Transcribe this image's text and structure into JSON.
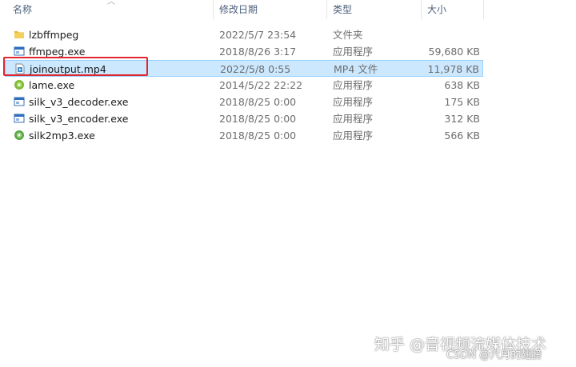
{
  "columns": {
    "name": "名称",
    "date": "修改日期",
    "type": "类型",
    "size": "大小"
  },
  "files": [
    {
      "name": "lzbffmpeg",
      "date": "2022/5/7 23:54",
      "type": "文件夹",
      "size": "",
      "icon": "folder-icon"
    },
    {
      "name": "ffmpeg.exe",
      "date": "2018/8/26 3:17",
      "type": "应用程序",
      "size": "59,680 KB",
      "icon": "exe-window-icon"
    },
    {
      "name": "joinoutput.mp4",
      "date": "2022/5/8 0:55",
      "type": "MP4 文件",
      "size": "11,978 KB",
      "icon": "video-file-icon"
    },
    {
      "name": "lame.exe",
      "date": "2014/5/22 22:22",
      "type": "应用程序",
      "size": "638 KB",
      "icon": "green-disc-icon"
    },
    {
      "name": "silk_v3_decoder.exe",
      "date": "2018/8/25 0:00",
      "type": "应用程序",
      "size": "175 KB",
      "icon": "exe-window-icon"
    },
    {
      "name": "silk_v3_encoder.exe",
      "date": "2018/8/25 0:00",
      "type": "应用程序",
      "size": "312 KB",
      "icon": "exe-window-icon"
    },
    {
      "name": "silk2mp3.exe",
      "date": "2018/8/25 0:00",
      "type": "应用程序",
      "size": "566 KB",
      "icon": "green-disc-icon"
    }
  ],
  "watermark": {
    "zhihu": "知乎 @音视频流媒体技术",
    "csdn": "CSDN @六月的翅膀"
  },
  "colors": {
    "selection": "#cce8ff",
    "highlight_border": "#e0262f",
    "folder": "#e8b73a"
  }
}
